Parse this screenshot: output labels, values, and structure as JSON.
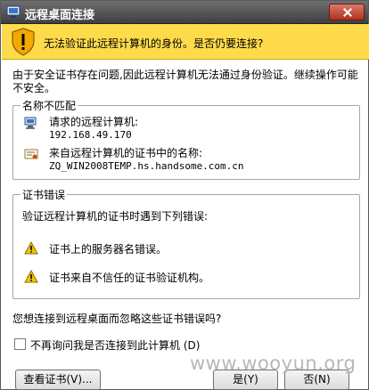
{
  "window": {
    "title": "远程桌面连接"
  },
  "banner": {
    "text": "无法验证此远程计算机的身份。是否仍要连接?",
    "color": "#fddb4a"
  },
  "intro": "由于安全证书存在问题,因此远程计算机无法通过身份验证。继续操作可能不安全。",
  "name_mismatch": {
    "label": "名称不匹配",
    "requested_label": "请求的远程计算机:",
    "requested_value": "192.168.49.170",
    "cert_label": "来自远程计算机的证书中的名称:",
    "cert_value": "ZQ_WIN2008TEMP.hs.handsome.com.cn"
  },
  "cert_errors": {
    "label": "证书错误",
    "intro": "验证远程计算机的证书时遇到下列错误:",
    "errors": [
      "证书上的服务器名错误。",
      "证书来自不信任的证书验证机构。"
    ]
  },
  "question": "您想连接到远程桌面而忽略这些证书错误吗?",
  "checkbox": {
    "label": "不再询问我是否连接到此计算机 (D)",
    "checked": false
  },
  "buttons": {
    "view_cert": "查看证书(V)...",
    "yes": "是(Y)",
    "no": "否(N)"
  },
  "watermark": "www.wooyun.org"
}
